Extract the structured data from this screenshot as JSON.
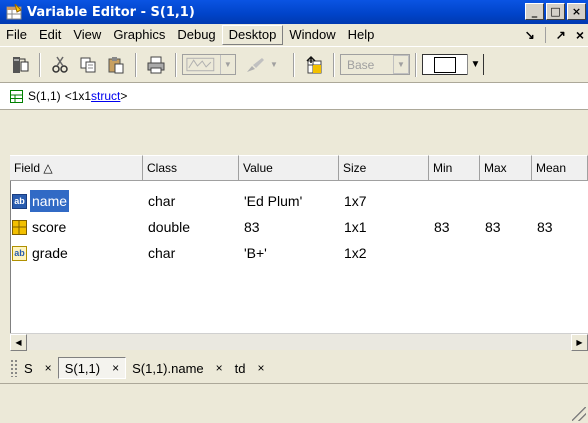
{
  "window": {
    "title": "Variable Editor - S(1,1)",
    "min": "_",
    "max": "□",
    "close": "×"
  },
  "menubar": {
    "items": [
      "File",
      "Edit",
      "View",
      "Graphics",
      "Debug",
      "Desktop",
      "Window",
      "Help"
    ],
    "undock": "↘",
    "maximize": "↗",
    "close": "×"
  },
  "toolbar": {
    "base_label": "Base"
  },
  "address": {
    "var": "S(1,1)",
    "desc": "<1x1 ",
    "link": "struct",
    "end": ">"
  },
  "table": {
    "columns": [
      "Field △",
      "Class",
      "Value",
      "Size",
      "Min",
      "Max",
      "Mean"
    ],
    "rows": [
      {
        "icon": "char-icon",
        "field": "name",
        "cls": "char",
        "value": "'Ed Plum'",
        "size": "1x7",
        "min": "",
        "max": "",
        "mean": ""
      },
      {
        "icon": "numeric-icon",
        "field": "score",
        "cls": "double",
        "value": "83",
        "size": "1x1",
        "min": "83",
        "max": "83",
        "mean": "83"
      },
      {
        "icon": "char-icon",
        "field": "grade",
        "cls": "char",
        "value": "'B+'",
        "size": "1x2",
        "min": "",
        "max": "",
        "mean": ""
      }
    ]
  },
  "tabs": [
    {
      "label": "S",
      "close": "×"
    },
    {
      "label": "S(1,1)",
      "close": "×"
    },
    {
      "label": "S(1,1).name",
      "close": "×"
    },
    {
      "label": "td",
      "close": "×"
    }
  ],
  "colors": {
    "title_bar": "#0054e3",
    "selection": "#316ac5",
    "numeric_icon": "#e0b000",
    "char_icon": "#2a5db0",
    "link": "#0000ee"
  }
}
